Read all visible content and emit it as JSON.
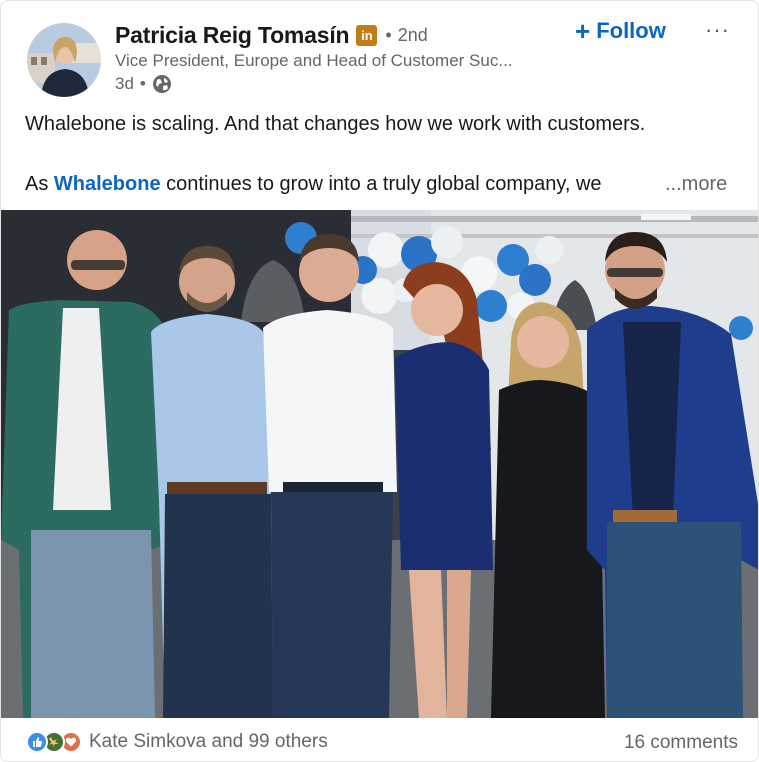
{
  "author": {
    "name": "Patricia Reig Tomasín",
    "badge": "in",
    "degree": "2nd",
    "headline": "Vice President, Europe and Head of Customer Suc...",
    "time": "3d",
    "visibility_icon": "globe-icon"
  },
  "actions": {
    "follow_label": "Follow",
    "more_label": "···"
  },
  "post": {
    "line1": "Whalebone is scaling. And that changes how we work with customers.",
    "line2_prefix": "As ",
    "mention": "Whalebone",
    "line2_suffix": " continues to grow into a truly global company, we",
    "see_more": "...more"
  },
  "social": {
    "reactions": [
      "like-icon",
      "celebrate-icon",
      "love-icon"
    ],
    "reactors": "Kate Simkova and 99 others",
    "comments": "16 comments"
  },
  "colors": {
    "accent": "#0a66c2",
    "badge": "#c37d16",
    "muted": "#666666"
  }
}
